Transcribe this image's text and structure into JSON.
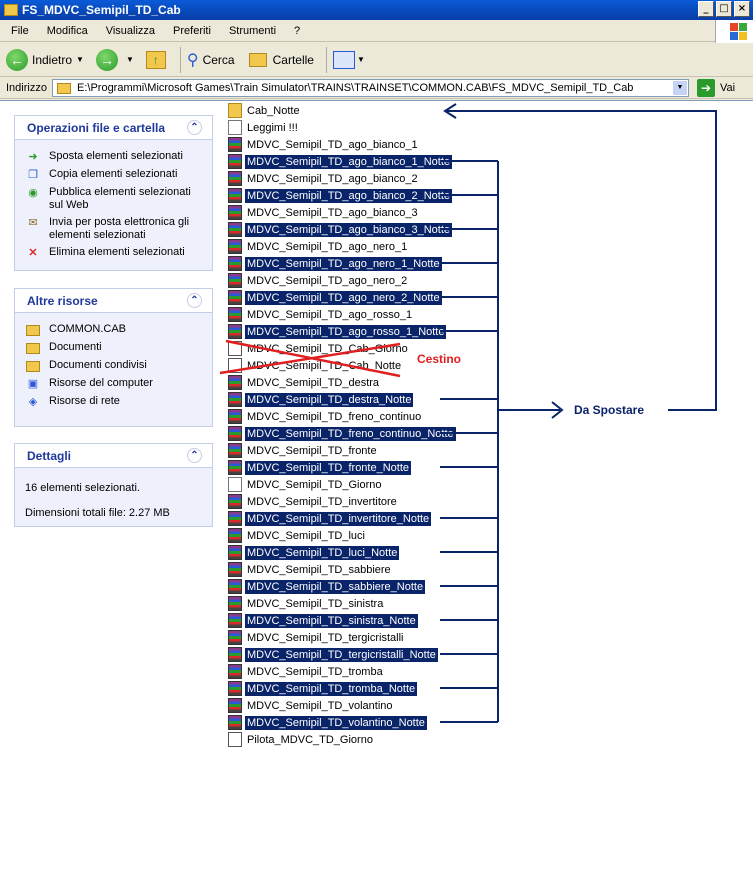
{
  "window": {
    "title": "FS_MDVC_Semipil_TD_Cab"
  },
  "menu": [
    "File",
    "Modifica",
    "Visualizza",
    "Preferiti",
    "Strumenti",
    "?"
  ],
  "toolbar": {
    "back": "Indietro",
    "search": "Cerca",
    "folders": "Cartelle"
  },
  "address": {
    "label": "Indirizzo",
    "path": "E:\\Programmi\\Microsoft Games\\Train Simulator\\TRAINS\\TRAINSET\\COMMON.CAB\\FS_MDVC_Semipil_TD_Cab",
    "go": "Vai"
  },
  "panels": {
    "tasks": {
      "title": "Operazioni file e cartella",
      "items": [
        "Sposta elementi selezionati",
        "Copia elementi selezionati",
        "Pubblica elementi selezionati sul Web",
        "Invia per posta elettronica gli elementi selezionati",
        "Elimina elementi selezionati"
      ]
    },
    "places": {
      "title": "Altre risorse",
      "items": [
        "COMMON.CAB",
        "Documenti",
        "Documenti condivisi",
        "Risorse del computer",
        "Risorse di rete"
      ]
    },
    "details": {
      "title": "Dettagli",
      "count": "16 elementi selezionati.",
      "size": "Dimensioni totali file: 2.27 MB"
    }
  },
  "files": [
    {
      "name": "Cab_Notte",
      "icon": "folder-icon",
      "selected": false
    },
    {
      "name": "Leggimi !!!",
      "icon": "text-file-icon",
      "selected": false
    },
    {
      "name": "MDVC_Semipil_TD_ago_bianco_1",
      "icon": "archive-icon",
      "selected": false
    },
    {
      "name": "MDVC_Semipil_TD_ago_bianco_1_Notte",
      "icon": "archive-icon",
      "selected": true
    },
    {
      "name": "MDVC_Semipil_TD_ago_bianco_2",
      "icon": "archive-icon",
      "selected": false
    },
    {
      "name": "MDVC_Semipil_TD_ago_bianco_2_Notte",
      "icon": "archive-icon",
      "selected": true
    },
    {
      "name": "MDVC_Semipil_TD_ago_bianco_3",
      "icon": "archive-icon",
      "selected": false
    },
    {
      "name": "MDVC_Semipil_TD_ago_bianco_3_Notte",
      "icon": "archive-icon",
      "selected": true
    },
    {
      "name": "MDVC_Semipil_TD_ago_nero_1",
      "icon": "archive-icon",
      "selected": false
    },
    {
      "name": "MDVC_Semipil_TD_ago_nero_1_Notte",
      "icon": "archive-icon",
      "selected": true
    },
    {
      "name": "MDVC_Semipil_TD_ago_nero_2",
      "icon": "archive-icon",
      "selected": false
    },
    {
      "name": "MDVC_Semipil_TD_ago_nero_2_Notte",
      "icon": "archive-icon",
      "selected": true
    },
    {
      "name": "MDVC_Semipil_TD_ago_rosso_1",
      "icon": "archive-icon",
      "selected": false
    },
    {
      "name": "MDVC_Semipil_TD_ago_rosso_1_Notte",
      "icon": "archive-icon",
      "selected": true
    },
    {
      "name": "MDVC_Semipil_TD_Cab_Giorno",
      "icon": "image-file-icon",
      "selected": false
    },
    {
      "name": "MDVC_Semipil_TD_Cab_Notte",
      "icon": "image-file-icon",
      "selected": false
    },
    {
      "name": "MDVC_Semipil_TD_destra",
      "icon": "archive-icon",
      "selected": false
    },
    {
      "name": "MDVC_Semipil_TD_destra_Notte",
      "icon": "archive-icon",
      "selected": true
    },
    {
      "name": "MDVC_Semipil_TD_freno_continuo",
      "icon": "archive-icon",
      "selected": false
    },
    {
      "name": "MDVC_Semipil_TD_freno_continuo_Notte",
      "icon": "archive-icon",
      "selected": true
    },
    {
      "name": "MDVC_Semipil_TD_fronte",
      "icon": "archive-icon",
      "selected": false
    },
    {
      "name": "MDVC_Semipil_TD_fronte_Notte",
      "icon": "archive-icon",
      "selected": true
    },
    {
      "name": "MDVC_Semipil_TD_Giorno",
      "icon": "text-file-icon",
      "selected": false
    },
    {
      "name": "MDVC_Semipil_TD_invertitore",
      "icon": "archive-icon",
      "selected": false
    },
    {
      "name": "MDVC_Semipil_TD_invertitore_Notte",
      "icon": "archive-icon",
      "selected": true
    },
    {
      "name": "MDVC_Semipil_TD_luci",
      "icon": "archive-icon",
      "selected": false
    },
    {
      "name": "MDVC_Semipil_TD_luci_Notte",
      "icon": "archive-icon",
      "selected": true
    },
    {
      "name": "MDVC_Semipil_TD_sabbiere",
      "icon": "archive-icon",
      "selected": false
    },
    {
      "name": "MDVC_Semipil_TD_sabbiere_Notte",
      "icon": "archive-icon",
      "selected": true
    },
    {
      "name": "MDVC_Semipil_TD_sinistra",
      "icon": "archive-icon",
      "selected": false
    },
    {
      "name": "MDVC_Semipil_TD_sinistra_Notte",
      "icon": "archive-icon",
      "selected": true
    },
    {
      "name": "MDVC_Semipil_TD_tergicristalli",
      "icon": "archive-icon",
      "selected": false
    },
    {
      "name": "MDVC_Semipil_TD_tergicristalli_Notte",
      "icon": "archive-icon",
      "selected": true
    },
    {
      "name": "MDVC_Semipil_TD_tromba",
      "icon": "archive-icon",
      "selected": false
    },
    {
      "name": "MDVC_Semipil_TD_tromba_Notte",
      "icon": "archive-icon",
      "selected": true
    },
    {
      "name": "MDVC_Semipil_TD_volantino",
      "icon": "archive-icon",
      "selected": false
    },
    {
      "name": "MDVC_Semipil_TD_volantino_Notte",
      "icon": "archive-icon",
      "selected": true
    },
    {
      "name": "Pilota_MDVC_TD_Giorno",
      "icon": "image-file-icon",
      "selected": false
    }
  ],
  "annotations": {
    "trash": "Cestino",
    "move": "Da Spostare",
    "trash_color": "#e02020",
    "arrow_color": "#0a246a"
  }
}
